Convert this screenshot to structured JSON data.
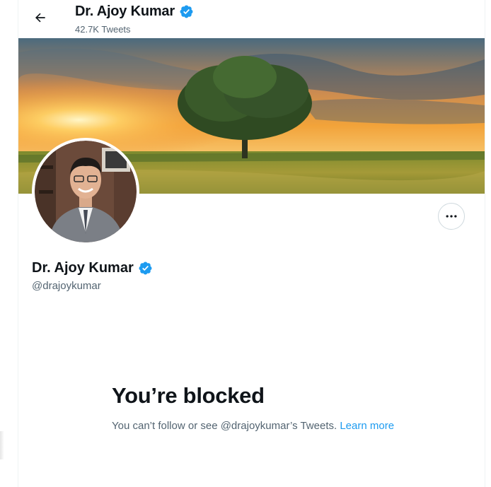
{
  "header": {
    "name": "Dr. Ajoy Kumar",
    "tweet_count": "42.7K Tweets"
  },
  "profile": {
    "name": "Dr. Ajoy Kumar",
    "handle": "@drajoykumar"
  },
  "blocked": {
    "title": "You’re blocked",
    "message": "You can’t follow or see @drajoykumar’s Tweets. ",
    "learn_more": "Learn more"
  },
  "colors": {
    "accent": "#1d9bf0",
    "text_primary": "#0f1419",
    "text_secondary": "#536471"
  },
  "icons": {
    "back": "back-arrow-icon",
    "verified": "verified-badge-icon",
    "more": "more-options-icon"
  }
}
